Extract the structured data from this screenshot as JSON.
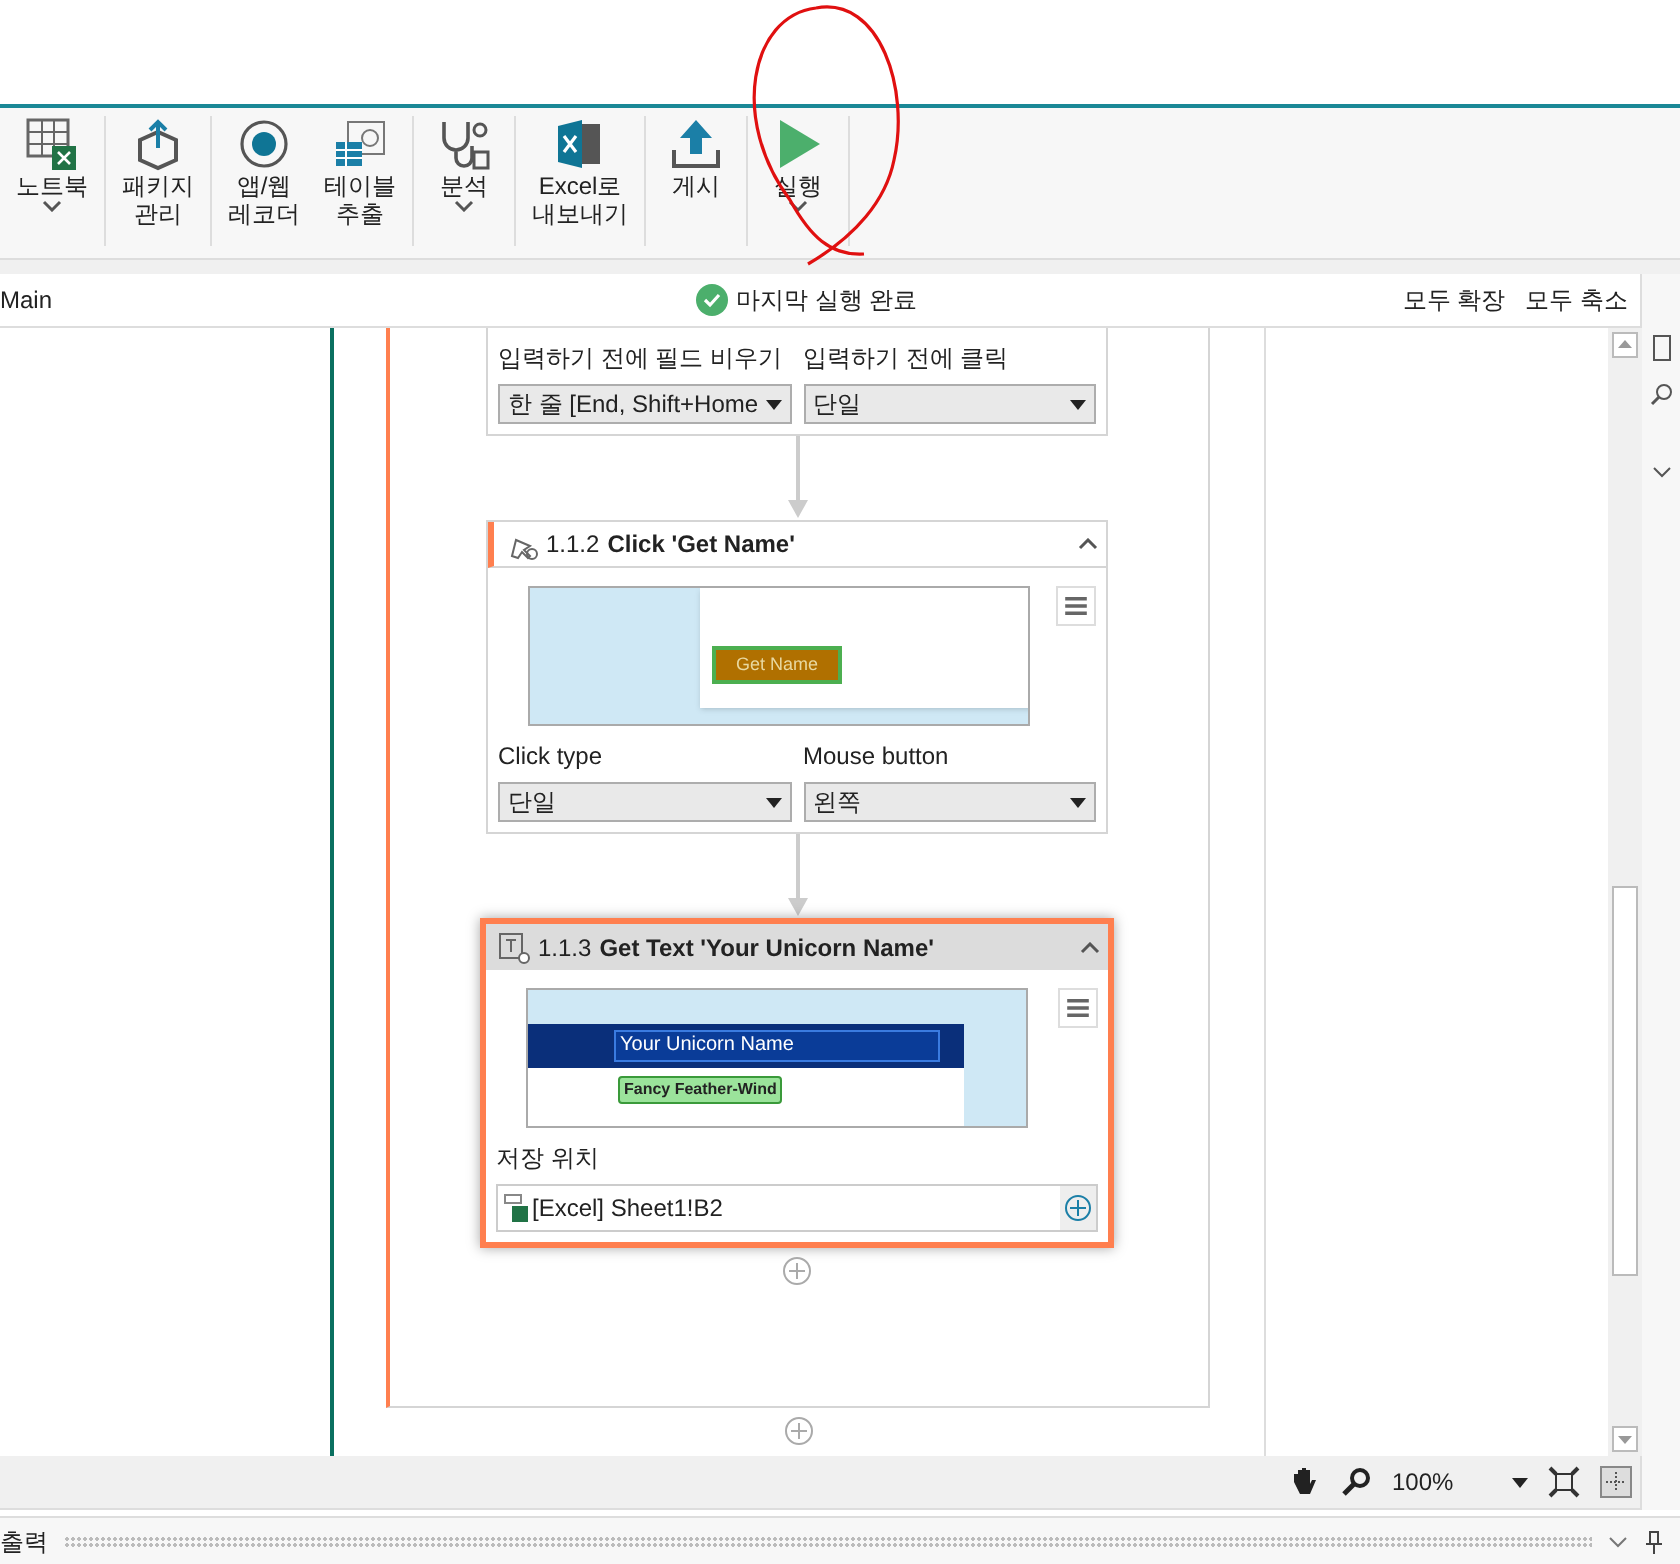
{
  "ribbon": {
    "groups": [
      {
        "items": [
          {
            "kind": "notebook",
            "lines": [
              "노트북"
            ],
            "dropdown": true
          }
        ]
      },
      {
        "items": [
          {
            "kind": "package",
            "lines": [
              "패키지",
              "관리"
            ],
            "dropdown": false
          }
        ]
      },
      {
        "items": [
          {
            "kind": "recorder",
            "lines": [
              "앱/웹",
              "레코더"
            ],
            "dropdown": false
          },
          {
            "kind": "table",
            "lines": [
              "테이블",
              "추출"
            ],
            "dropdown": false
          }
        ]
      },
      {
        "items": [
          {
            "kind": "analyze",
            "lines": [
              "분석"
            ],
            "dropdown": true
          }
        ]
      },
      {
        "items": [
          {
            "kind": "excel",
            "lines": [
              "Excel로",
              "내보내기"
            ],
            "dropdown": false
          }
        ]
      },
      {
        "items": [
          {
            "kind": "publish",
            "lines": [
              "게시"
            ],
            "dropdown": false
          }
        ]
      },
      {
        "items": [
          {
            "kind": "run",
            "lines": [
              "실행"
            ],
            "dropdown": true
          }
        ]
      }
    ]
  },
  "header": {
    "title": "Main",
    "status": {
      "kind": "success",
      "text": "마지막 실행 완료"
    },
    "actions": [
      "모두 확장",
      "모두 축소"
    ]
  },
  "steps": [
    {
      "kind": "partial",
      "fields": [
        {
          "label": "입력하기 전에 필드 비우기",
          "value": "한 줄 [End, Shift+Home"
        },
        {
          "label": "입력하기 전에 클릭",
          "value": "단일"
        }
      ]
    },
    {
      "kind": "click",
      "number": "1.1.2",
      "title": "Click 'Get Name'",
      "selected": false,
      "expanded": true,
      "preview": [
        "Get Name"
      ],
      "fields": [
        {
          "label": "Click type",
          "value": "단일"
        },
        {
          "label": "Mouse button",
          "value": "왼쪽"
        }
      ]
    },
    {
      "kind": "gettext",
      "number": "1.1.3",
      "title": "Get Text 'Your Unicorn Name'",
      "selected": true,
      "expanded": true,
      "preview": [
        "Your Unicorn Name",
        "Fancy Feather-Wind"
      ],
      "target": {
        "label": "저장 위치",
        "value": "[Excel] Sheet1!B2"
      }
    }
  ],
  "zoom": {
    "value": "100%"
  },
  "output": {
    "title": "출력"
  }
}
